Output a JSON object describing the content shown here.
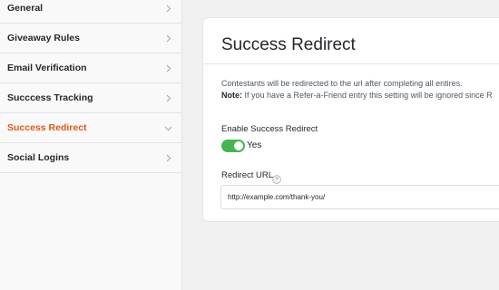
{
  "sidebar": {
    "items": [
      {
        "label": "General",
        "active": false
      },
      {
        "label": "Giveaway Rules",
        "active": false
      },
      {
        "label": "Email Verification",
        "active": false
      },
      {
        "label": "Succcess Tracking",
        "active": false
      },
      {
        "label": "Success Redirect",
        "active": true
      },
      {
        "label": "Social Logins",
        "active": false
      }
    ]
  },
  "panel": {
    "title": "Success Redirect",
    "description": "Contestants will be redirected to the url after completing all entires.",
    "note_label": "Note:",
    "note_text": " If you have a Refer-a-Friend entry this setting will be ignored since R",
    "enable_label": "Enable Success Redirect",
    "toggle_state": "Yes",
    "toggle_on": true,
    "redirect_label": "Redirect URL",
    "redirect_value": "http://example.com/thank-you/"
  },
  "colors": {
    "accent": "#e0561b",
    "toggle_on": "#46b450"
  }
}
